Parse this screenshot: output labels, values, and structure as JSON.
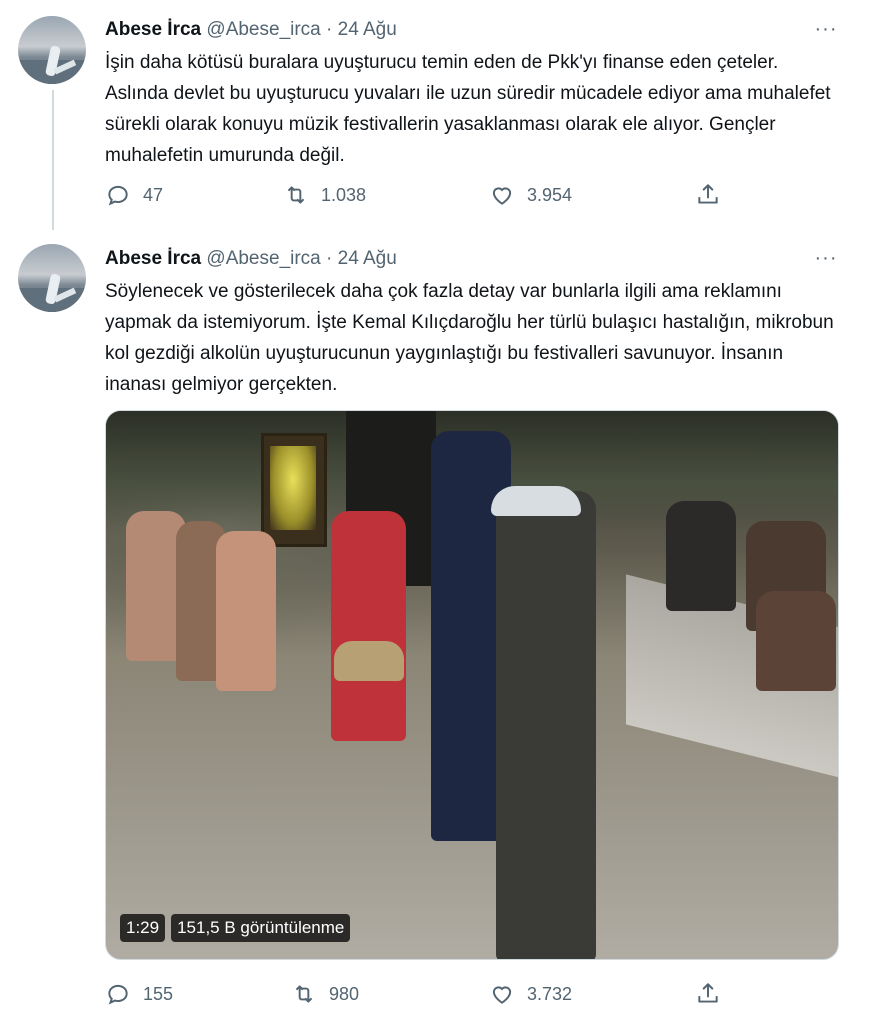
{
  "tweets": [
    {
      "author_name": "Abese İrca",
      "handle": "@Abese_irca",
      "separator": "·",
      "date": "24 Ağu",
      "text": "İşin daha kötüsü buralara uyuşturucu temin eden de Pkk'yı finanse eden çeteler. Aslında devlet bu uyuşturucu yuvaları ile uzun süredir mücadele ediyor ama muhalefet sürekli olarak konuyu müzik festivallerin yasaklanması olarak ele alıyor. Gençler muhalefetin umurunda değil.",
      "replies": "47",
      "retweets": "1.038",
      "likes": "3.954"
    },
    {
      "author_name": "Abese İrca",
      "handle": "@Abese_irca",
      "separator": "·",
      "date": "24 Ağu",
      "text": "Söylenecek ve gösterilecek daha çok fazla detay var bunlarla ilgili ama reklamını yapmak da istemiyorum. İşte Kemal Kılıçdaroğlu her türlü bulaşıcı hastalığın, mikrobun kol gezdiği alkolün uyuşturucunun yaygınlaştığı bu festivalleri savunuyor. İnsanın inanası gelmiyor gerçekten.",
      "replies": "155",
      "retweets": "980",
      "likes": "3.732",
      "video": {
        "duration": "1:29",
        "views": "151,5 B görüntülenme"
      }
    }
  ],
  "icons": {
    "more": "more-horizontal-icon",
    "reply": "reply-icon",
    "retweet": "retweet-icon",
    "like": "heart-icon",
    "share": "share-icon"
  },
  "colors": {
    "text": "#0f1419",
    "secondary": "#536471",
    "thread_line": "#cfd9de"
  }
}
